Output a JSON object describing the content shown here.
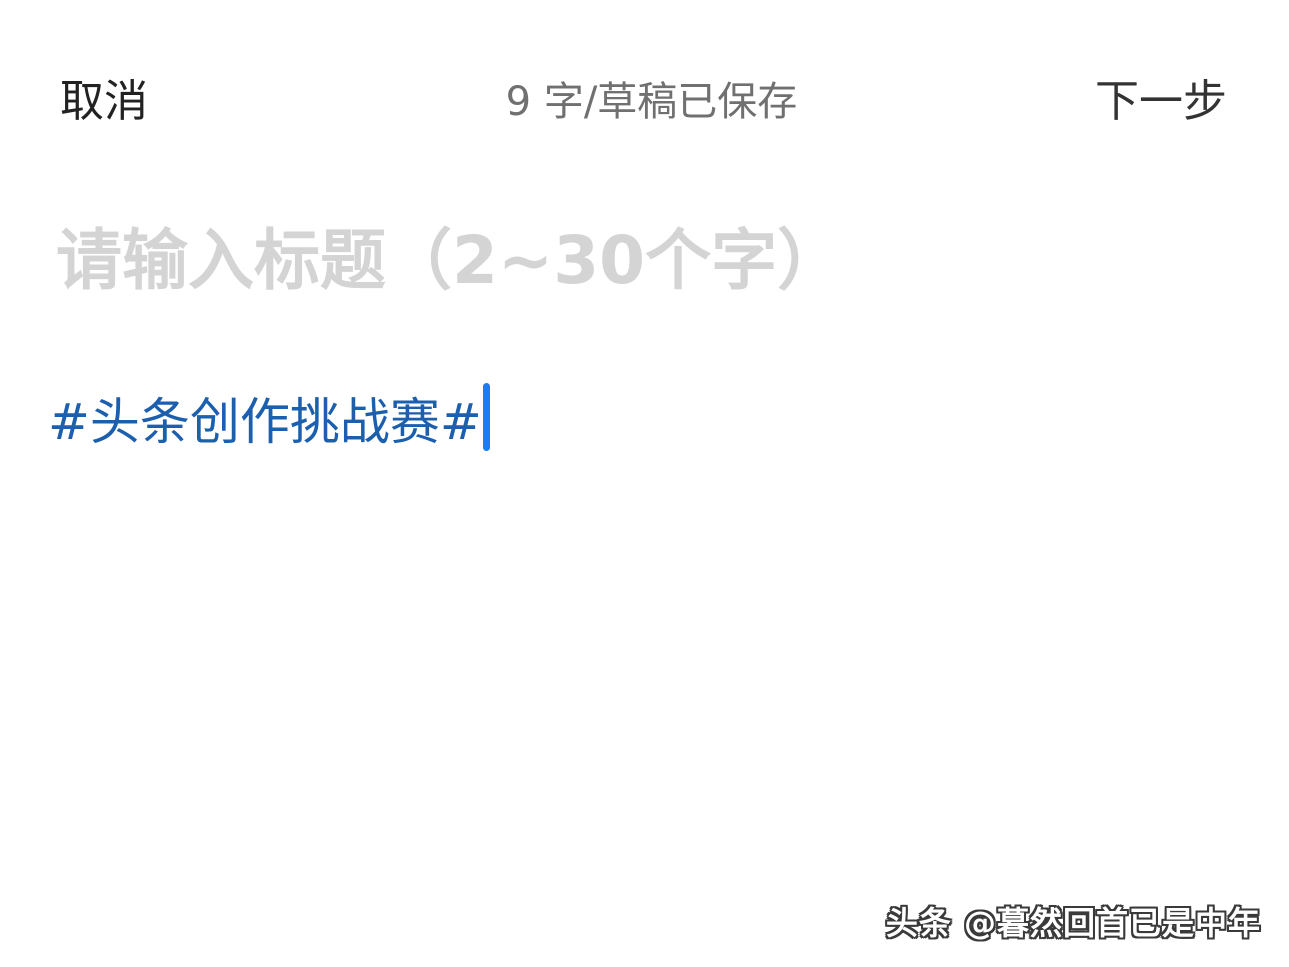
{
  "header": {
    "cancel_label": "取消",
    "status_text": "9 字/草稿已保存",
    "next_label": "下一步"
  },
  "title_field": {
    "placeholder": "请输入标题（2~30个字）",
    "value": ""
  },
  "body": {
    "topic_tag": "#头条创作挑战赛#"
  },
  "watermark": {
    "text": "头条 @暮然回首已是中年"
  },
  "colors": {
    "topic_link": "#1b5fae",
    "cursor": "#1a7cf0",
    "placeholder": "#d4d4d4",
    "status": "#707070"
  }
}
